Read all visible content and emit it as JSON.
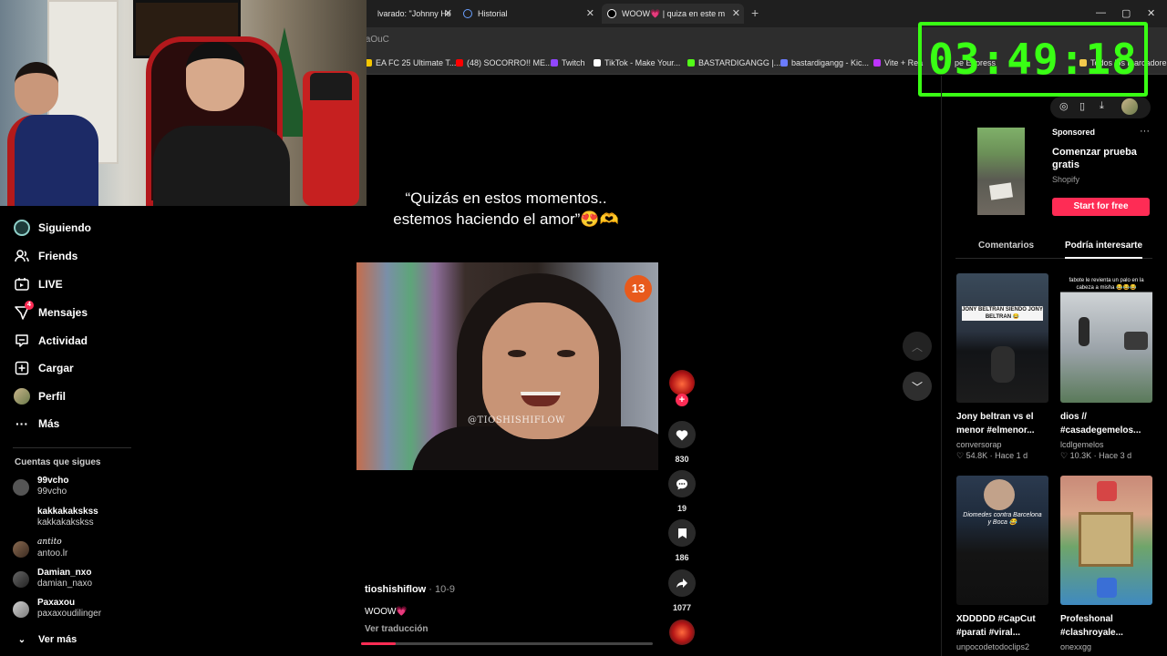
{
  "browser": {
    "tabs": [
      {
        "label": "lvarado: \"Johnny He",
        "active": false
      },
      {
        "label": "Historial",
        "active": false
      },
      {
        "label": "WOOW💗 | quiza en este m",
        "active": true
      }
    ],
    "new_tab_label": "+",
    "window_controls": [
      "—",
      "▢",
      "✕"
    ],
    "url": "taOuC",
    "bookmarks": [
      {
        "label": "EA FC 25 Ultimate T...",
        "color": "#f6c700"
      },
      {
        "label": "(48) SOCORRO!! ME...",
        "color": "#ff0000"
      },
      {
        "label": "Twitch",
        "color": "#9146ff"
      },
      {
        "label": "TikTok - Make Your...",
        "color": "#ffffff"
      },
      {
        "label": "BASTARDIGANGG |...",
        "color": "#53fc18"
      },
      {
        "label": "bastardigangg - Kic...",
        "color": "#6b7cff"
      },
      {
        "label": "Vite + Rea",
        "color": "#bd34fe"
      },
      {
        "label": "pe Express",
        "color": "#888888"
      },
      {
        "label": "Todos los marcadores",
        "color": "#f2c94c"
      }
    ]
  },
  "timer": {
    "value": "03:49:18",
    "color": "#39ff14"
  },
  "sidebar": {
    "items": [
      {
        "label": "Siguiendo",
        "icon": "following-avatar-icon"
      },
      {
        "label": "Friends",
        "icon": "friends-icon"
      },
      {
        "label": "LIVE",
        "icon": "live-icon"
      },
      {
        "label": "Mensajes",
        "icon": "messages-icon",
        "badge": "4"
      },
      {
        "label": "Actividad",
        "icon": "activity-icon"
      },
      {
        "label": "Cargar",
        "icon": "upload-icon"
      },
      {
        "label": "Perfil",
        "icon": "profile-icon"
      },
      {
        "label": "Más",
        "icon": "more-icon"
      }
    ],
    "following_title": "Cuentas que sigues",
    "accounts": [
      {
        "name": "99vcho",
        "handle": "99vcho"
      },
      {
        "name": "kakkakakskss",
        "handle": "kakkakakskss"
      },
      {
        "name": "antito",
        "handle": "antoo.lr"
      },
      {
        "name": "Damian_nxo",
        "handle": "damian_naxo"
      },
      {
        "name": "Paxaxou",
        "handle": "paxaxoudilinger"
      }
    ],
    "see_more": "Ver más"
  },
  "video": {
    "caption_line1": "“Quizás en estos momentos..",
    "caption_line2": "estemos haciendo el amor”😍🫶",
    "channel_logo": "13",
    "watermark": "@TIOSHISHIFLOW",
    "author": "tioshishiflow",
    "date": " · 10-9",
    "description": "WOOW💗",
    "translate": "Ver traducción",
    "progress": 0.12,
    "likes": "830",
    "comments": "19",
    "saves": "186",
    "shares": "1077",
    "follow_plus": "+"
  },
  "right_panel": {
    "ad": {
      "sponsored": "Sponsored",
      "title": "Comenzar prueba gratis",
      "brand": "Shopify",
      "cta": "Start for free",
      "more": "···"
    },
    "tabs": {
      "comments": "Comentarios",
      "suggested": "Podría interesarte"
    },
    "cards": [
      {
        "title": "Jony beltran vs el menor #elmenor...",
        "author": "conversorap",
        "meta": "54.8K · Hace 1 d",
        "thumb_text": "JONY BELTRAN SIENDO JONY BELTRAN 😂"
      },
      {
        "title": "dios // #casadegemelos...",
        "author": "lcdlgemelos",
        "meta": "10.3K · Hace 3 d",
        "thumb_text": "fabote le revienta un palo en la cabeza a misha 😂😂😂"
      },
      {
        "title": "XDDDDD #CapCut #parati #viral...",
        "author": "unpocodetodoclips2",
        "meta": "",
        "thumb_text": "Diomedes contra Barcelona y Boca 😂"
      },
      {
        "title": "Profeshonal #clashroyale...",
        "author": "onexxgg",
        "meta": "",
        "thumb_text": ""
      }
    ]
  }
}
